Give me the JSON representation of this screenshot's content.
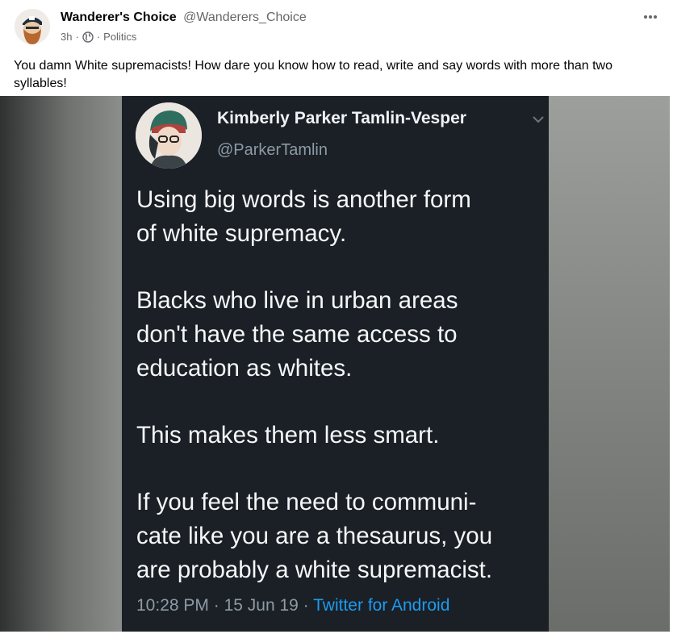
{
  "post": {
    "author_name": "Wanderer's Choice",
    "author_handle": "@Wanderers_Choice",
    "time": "3h",
    "separator": "·",
    "category": "Politics",
    "more_icon": "more-horizontal-icon",
    "text": "You damn White supremacists! How dare you know how to read, write and say words with more than two syllables!"
  },
  "tweet": {
    "name": "Kimberly Parker Tamlin-Vesper",
    "handle": "@ParkerTamlin",
    "paragraphs": [
      "Using big words is another form\nof white supremacy.",
      "Blacks who live in urban areas\ndon't have the same access to\neducation as whites.",
      "This makes them less smart.",
      "If you feel the need to communi-\ncate like you are a thesaurus, you\nare probably a white supremacist."
    ],
    "time": "10:28 PM",
    "date": "15 Jun 19",
    "separator": "·",
    "source": "Twitter for Android"
  }
}
